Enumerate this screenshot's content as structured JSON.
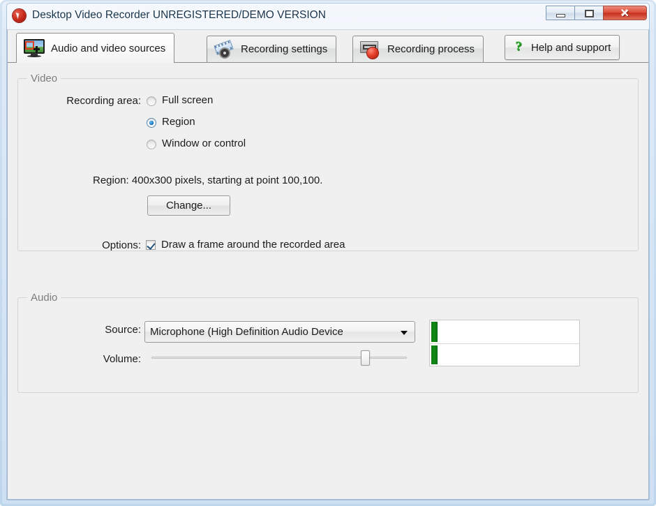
{
  "window": {
    "title": "Desktop Video Recorder UNREGISTERED/DEMO VERSION",
    "app_icon": "record-app-icon",
    "buttons": {
      "minimize": "minimize-icon",
      "maximize": "maximize-icon",
      "close": "✕"
    }
  },
  "tabs": [
    {
      "label": "Audio and video sources",
      "icon": "monitor-region-icon",
      "active": true
    },
    {
      "label": "Recording settings",
      "icon": "film-gear-icon",
      "active": false
    },
    {
      "label": "Recording process",
      "icon": "tape-record-icon",
      "active": false
    }
  ],
  "help_tab": {
    "label": "Help and support",
    "icon": "green-question-icon"
  },
  "video_group": {
    "title": "Video",
    "recording_area_label": "Recording area:",
    "options": [
      {
        "label": "Full screen",
        "selected": false
      },
      {
        "label": "Region",
        "selected": true
      },
      {
        "label": "Window or control",
        "selected": false
      }
    ],
    "region_label": "Region:",
    "region_value": "400x300 pixels, starting at point 100,100.",
    "region_text": "Region: 400x300 pixels, starting at point 100,100.",
    "change_button": "Change...",
    "options_label": "Options:",
    "frame_checkbox": {
      "label": "Draw a frame around the recorded area",
      "checked": true
    }
  },
  "audio_group": {
    "title": "Audio",
    "source_label": "Source:",
    "source_value": "Microphone (High Definition Audio Device",
    "volume_label": "Volume:",
    "volume_percent": 85,
    "meters": [
      {
        "name": "left-channel",
        "level_percent": 4
      },
      {
        "name": "right-channel",
        "level_percent": 4
      }
    ]
  },
  "colors": {
    "accent_blue": "#1a70b8",
    "record_red": "#e5402c",
    "meter_green": "#0f8b16",
    "group_text": "#7d7d7d",
    "client_bg": "#f0f0f0"
  }
}
